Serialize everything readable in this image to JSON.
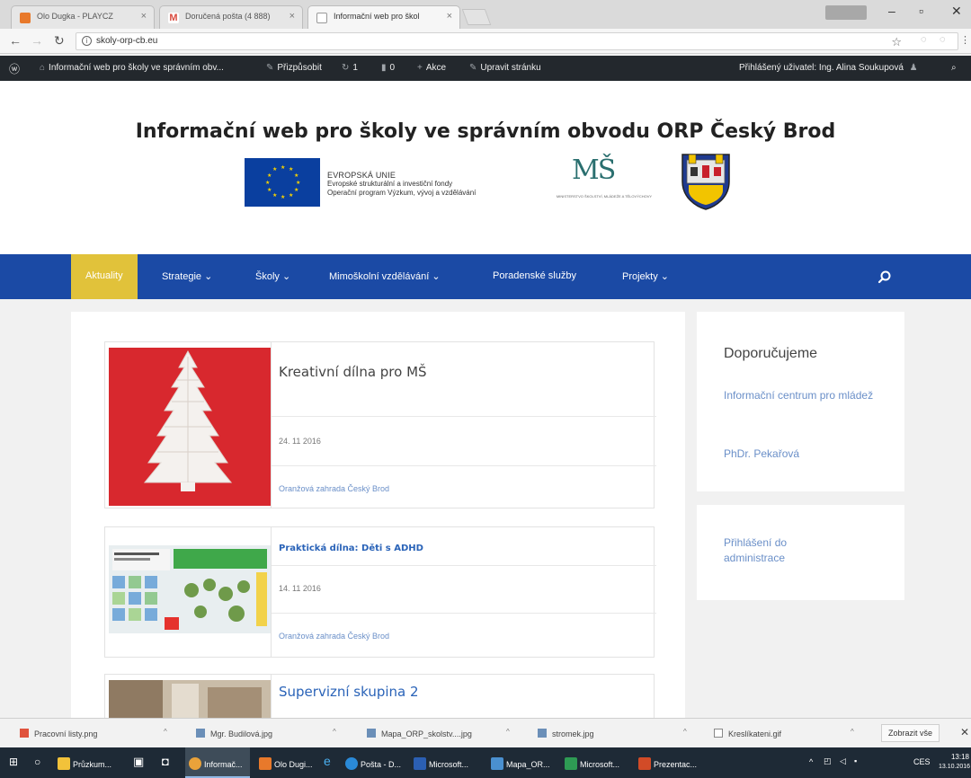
{
  "browser": {
    "tabs": [
      {
        "label": "Olo Dugka - PLAYCZ",
        "favicon_color": "#e8792b"
      },
      {
        "label": "Doručená pošta (4 888)",
        "favicon_color": "#d94b3f"
      },
      {
        "label": "Informační web pro škol",
        "favicon_color": "#9a9a9a"
      }
    ],
    "url": "skoly-orp-cb.eu",
    "window_controls": {
      "minimize": "–",
      "maximize": "▫",
      "close": "✕"
    }
  },
  "admin_bar": {
    "site_name": "Informační web pro školy ve správním obv...",
    "customize": "Přizpůsobit",
    "updates_count": "1",
    "comments_count": "0",
    "new_item": "Akce",
    "edit_page": "Upravit stránku",
    "greeting": "Přihlášený uživatel: Ing. Alina Soukupová"
  },
  "header": {
    "title": "Informační web pro školy ve správním obvodu ORP Český Brod",
    "eu_lines": [
      "EVROPSKÁ UNIE",
      "Evropské strukturální a investiční fondy",
      "Operační program Výzkum, vývoj a vzdělávání"
    ],
    "msmt_caption": "MINISTERSTVO ŠKOLSTVÍ, MLÁDEŽE A TĚLOVÝCHOVY"
  },
  "nav": {
    "items": [
      {
        "label": "Aktuality"
      },
      {
        "label": "Strategie ⌄"
      },
      {
        "label": "Školy ⌄"
      },
      {
        "label": "Mimoškolní vzdělávání ⌄"
      },
      {
        "label": "Poradenské služby"
      },
      {
        "label": "Projekty ⌄"
      }
    ],
    "accent_color": "#1b4aa5",
    "current_color": "#e1c23a"
  },
  "posts": [
    {
      "title": "Kreativní dílna pro MŠ",
      "date": "24. 11 2016",
      "category": "Oranžová zahrada Český Brod"
    },
    {
      "title": "Praktická dílna: Děti s ADHD",
      "date": "14. 11 2016",
      "category": "Oranžová zahrada Český Brod"
    },
    {
      "title": "Supervizní skupina 2"
    }
  ],
  "sidebar": {
    "recommended_title": "Doporučujeme",
    "recommended_links": [
      "Informační centrum pro mládež",
      "PhDr. Pekařová"
    ],
    "login_link": "Přihlášení do administrace"
  },
  "downloads": {
    "items": [
      "Pracovní listy.png",
      "Mgr. Budilová.jpg",
      "Mapa_ORP_skolstv....jpg",
      "stromek.jpg",
      "Kreslíkateni.gif"
    ],
    "show_all": "Zobrazit vše"
  },
  "taskbar": {
    "items": [
      "Průzkum...",
      "Informač...",
      "Olo Dugi...",
      "Pošta - D...",
      "Microsoft...",
      "Mapa_OR...",
      "Microsoft...",
      "Prezentac..."
    ],
    "language": "CES",
    "time": "13:18",
    "date": "13.10.2016"
  }
}
